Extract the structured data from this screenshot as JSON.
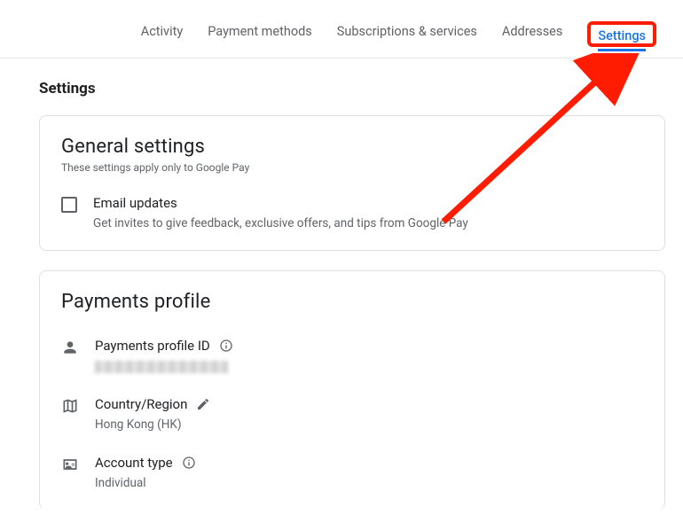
{
  "tabs": {
    "activity": "Activity",
    "methods": "Payment methods",
    "subs": "Subscriptions & services",
    "addresses": "Addresses",
    "settings": "Settings"
  },
  "page_title": "Settings",
  "general": {
    "heading": "General settings",
    "sub": "These settings apply only to Google Pay",
    "email_updates": {
      "label": "Email updates",
      "desc": "Get invites to give feedback, exclusive offers, and tips from Google Pay"
    }
  },
  "profile": {
    "heading": "Payments profile",
    "id": {
      "label": "Payments profile ID"
    },
    "region": {
      "label": "Country/Region",
      "value": "Hong Kong (HK)"
    },
    "account_type": {
      "label": "Account type",
      "value": "Individual"
    }
  }
}
